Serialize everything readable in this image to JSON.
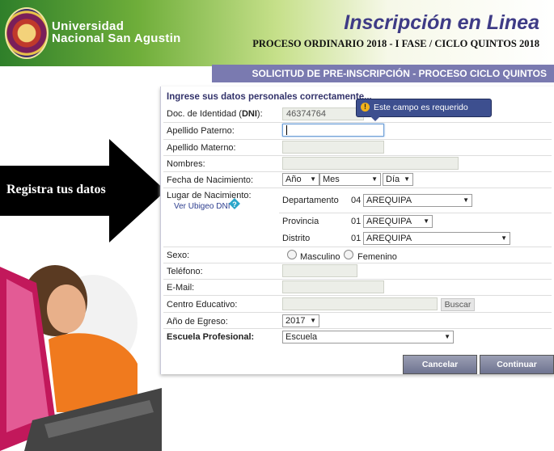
{
  "header": {
    "university_line1": "Universidad",
    "university_line2": "Nacional San Agustin",
    "app_title": "Inscripción en Linea",
    "process": "PROCESO ORDINARIO 2018 - I FASE / CICLO QUINTOS 2018"
  },
  "banner": {
    "arrow_text": "Registra tus datos"
  },
  "form": {
    "section_title": "SOLICITUD DE PRE-INSCRIPCIÓN - PROCESO CICLO QUINTOS",
    "panel_title": "Ingrese sus datos personales correctamente...",
    "dni_label_pre": "Doc. de Identidad (",
    "dni_label_bold": "DNI",
    "dni_label_post": "):",
    "dni_value": "46374764",
    "tooltip": "Este campo es requerido",
    "apellido_paterno_label": "Apellido Paterno:",
    "apellido_materno_label": "Apellido Materno:",
    "nombres_label": "Nombres:",
    "fecha_label": "Fecha de Nacimiento:",
    "fecha_anio": "Año",
    "fecha_mes": "Mes",
    "fecha_dia": "Día",
    "lugar_label": "Lugar de Nacimiento:",
    "ubigeo_link": "Ver Ubigeo DNI",
    "departamento_label": "Departamento",
    "departamento_code": "04",
    "departamento_value": "AREQUIPA",
    "provincia_label": "Provincia",
    "provincia_code": "01",
    "provincia_value": "AREQUIPA",
    "distrito_label": "Distrito",
    "distrito_code": "01",
    "distrito_value": "AREQUIPA",
    "sexo_label": "Sexo:",
    "sexo_masculino": "Masculino",
    "sexo_femenino": "Femenino",
    "telefono_label": "Teléfono:",
    "email_label": "E-Mail:",
    "centro_label": "Centro Educativo:",
    "buscar_label": "Buscar",
    "egreso_label": "Año de Egreso:",
    "egreso_value": "2017",
    "escuela_label": "Escuela Profesional:",
    "escuela_value": "Escuela",
    "cancel_label": "Cancelar",
    "continue_label": "Continuar"
  },
  "colors": {
    "accent": "#7a7ab0",
    "title_text": "#3e3b86",
    "tooltip_bg": "#3d4f8f"
  }
}
